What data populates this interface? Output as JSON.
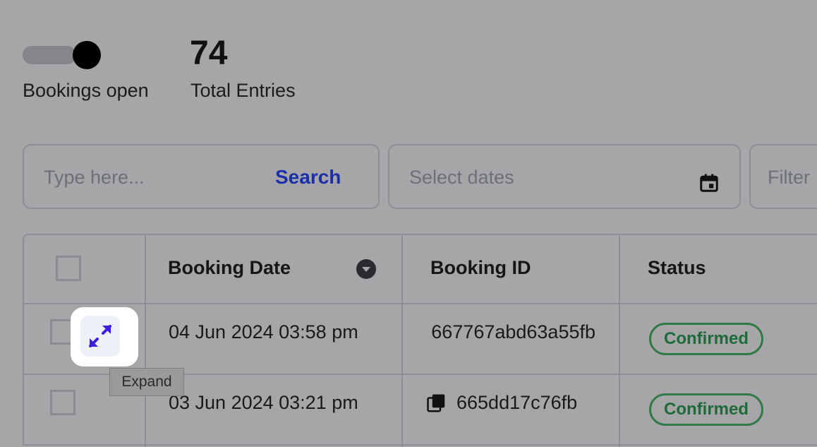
{
  "stats": {
    "bookings_label": "Bookings open",
    "total_value": "74",
    "total_label": "Total Entries"
  },
  "search": {
    "placeholder": "Type here...",
    "button_label": "Search",
    "dates_placeholder": "Select dates",
    "filter_placeholder": "Filter"
  },
  "table": {
    "columns": [
      "Booking Date",
      "Booking ID",
      "Status"
    ],
    "rows": [
      {
        "date": "04 Jun 2024 03:58 pm",
        "id": "667767abd63a55fb",
        "status": "Confirmed"
      },
      {
        "date": "03 Jun 2024 03:21 pm",
        "id": "665dd17c76fb",
        "status": "Confirmed"
      }
    ]
  },
  "tooltip": {
    "expand_label": "Expand"
  },
  "colors": {
    "accent": "#1a2fa8",
    "confirmed": "#2f7a47",
    "expand": "#3a1fe0"
  }
}
